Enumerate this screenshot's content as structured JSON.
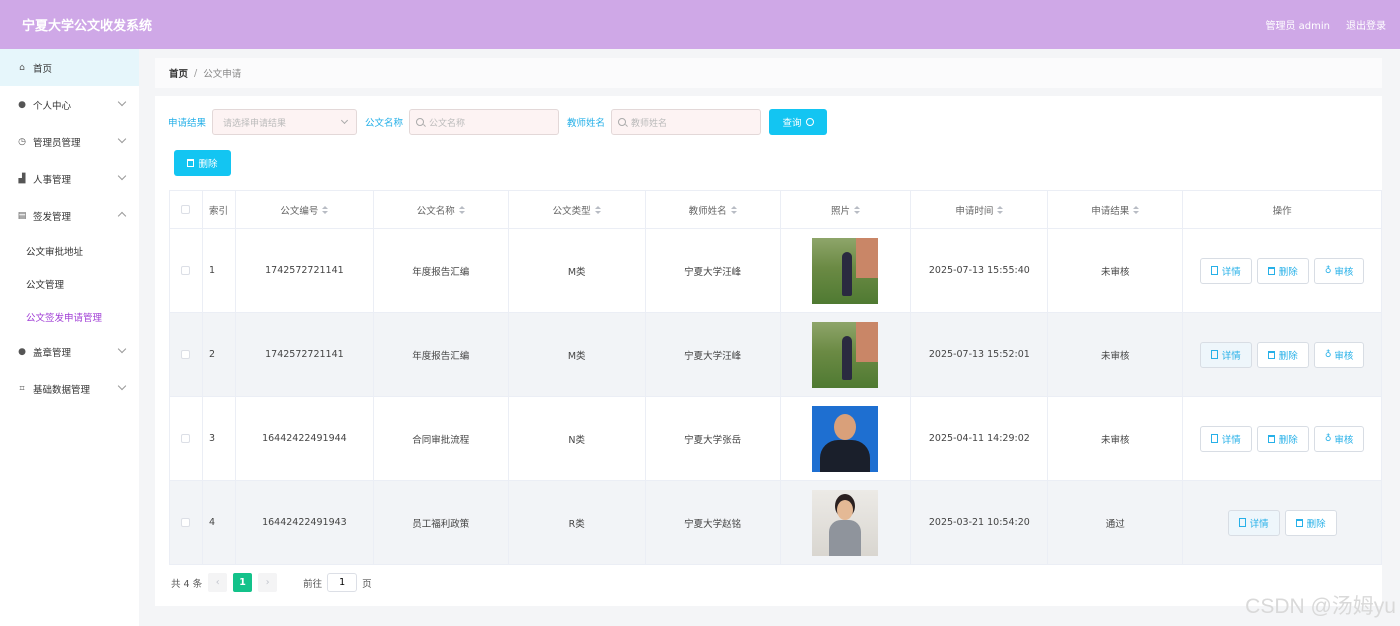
{
  "app": {
    "title": "宁夏大学公文收发系统"
  },
  "header": {
    "user": "管理员 admin",
    "logout": "退出登录"
  },
  "sidebar": {
    "items": [
      {
        "label": "首页",
        "icon": "home-icon"
      },
      {
        "label": "个人中心",
        "icon": "user-icon"
      },
      {
        "label": "管理员管理",
        "icon": "clock-icon"
      },
      {
        "label": "人事管理",
        "icon": "chart-icon"
      },
      {
        "label": "签发管理",
        "icon": "clipboard-icon"
      },
      {
        "label": "盖章管理",
        "icon": "user-icon"
      },
      {
        "label": "基础数据管理",
        "icon": "crop-icon"
      }
    ],
    "sub_items": [
      "公文审批地址",
      "公文管理",
      "公文签发申请管理"
    ]
  },
  "breadcrumb": {
    "home": "首页",
    "sep": "/",
    "current": "公文申请"
  },
  "filters": {
    "result_label": "申请结果",
    "result_placeholder": "请选择申请结果",
    "name_label": "公文名称",
    "name_placeholder": "公文名称",
    "teacher_label": "教师姓名",
    "teacher_placeholder": "教师姓名",
    "query_button": "查询"
  },
  "actions": {
    "delete_button": "删除"
  },
  "table": {
    "headers": [
      "索引",
      "公文编号",
      "公文名称",
      "公文类型",
      "教师姓名",
      "照片",
      "申请时间",
      "申请结果",
      "操作"
    ],
    "rows": [
      {
        "index": "1",
        "code": "1742572721141",
        "name": "年度报告汇编",
        "type": "M类",
        "teacher": "宁夏大学汪峰",
        "photo": "garden",
        "time": "2025-07-13 15:55:40",
        "result": "未审核",
        "ops": [
          "详情",
          "删除",
          "审核"
        ]
      },
      {
        "index": "2",
        "code": "1742572721141",
        "name": "年度报告汇编",
        "type": "M类",
        "teacher": "宁夏大学汪峰",
        "photo": "garden",
        "time": "2025-07-13 15:52:01",
        "result": "未审核",
        "ops": [
          "详情",
          "删除",
          "审核"
        ]
      },
      {
        "index": "3",
        "code": "16442422491944",
        "name": "合同审批流程",
        "type": "N类",
        "teacher": "宁夏大学张岳",
        "photo": "suit",
        "time": "2025-04-11 14:29:02",
        "result": "未审核",
        "ops": [
          "详情",
          "删除",
          "审核"
        ]
      },
      {
        "index": "4",
        "code": "16442422491943",
        "name": "员工福利政策",
        "type": "R类",
        "teacher": "宁夏大学赵铭",
        "photo": "office",
        "time": "2025-03-21 10:54:20",
        "result": "通过",
        "ops": [
          "详情",
          "删除"
        ]
      }
    ]
  },
  "pagination": {
    "total": "共 4 条",
    "current_page": "1",
    "goto_prefix": "前往",
    "goto_value": "1",
    "goto_suffix": "页"
  },
  "watermark": "CSDN @汤姆yu",
  "colors": {
    "header": "#cfa8e7",
    "accent": "#13c5f2",
    "active_page": "#13c28a",
    "current_sub": "#a13fd6"
  }
}
